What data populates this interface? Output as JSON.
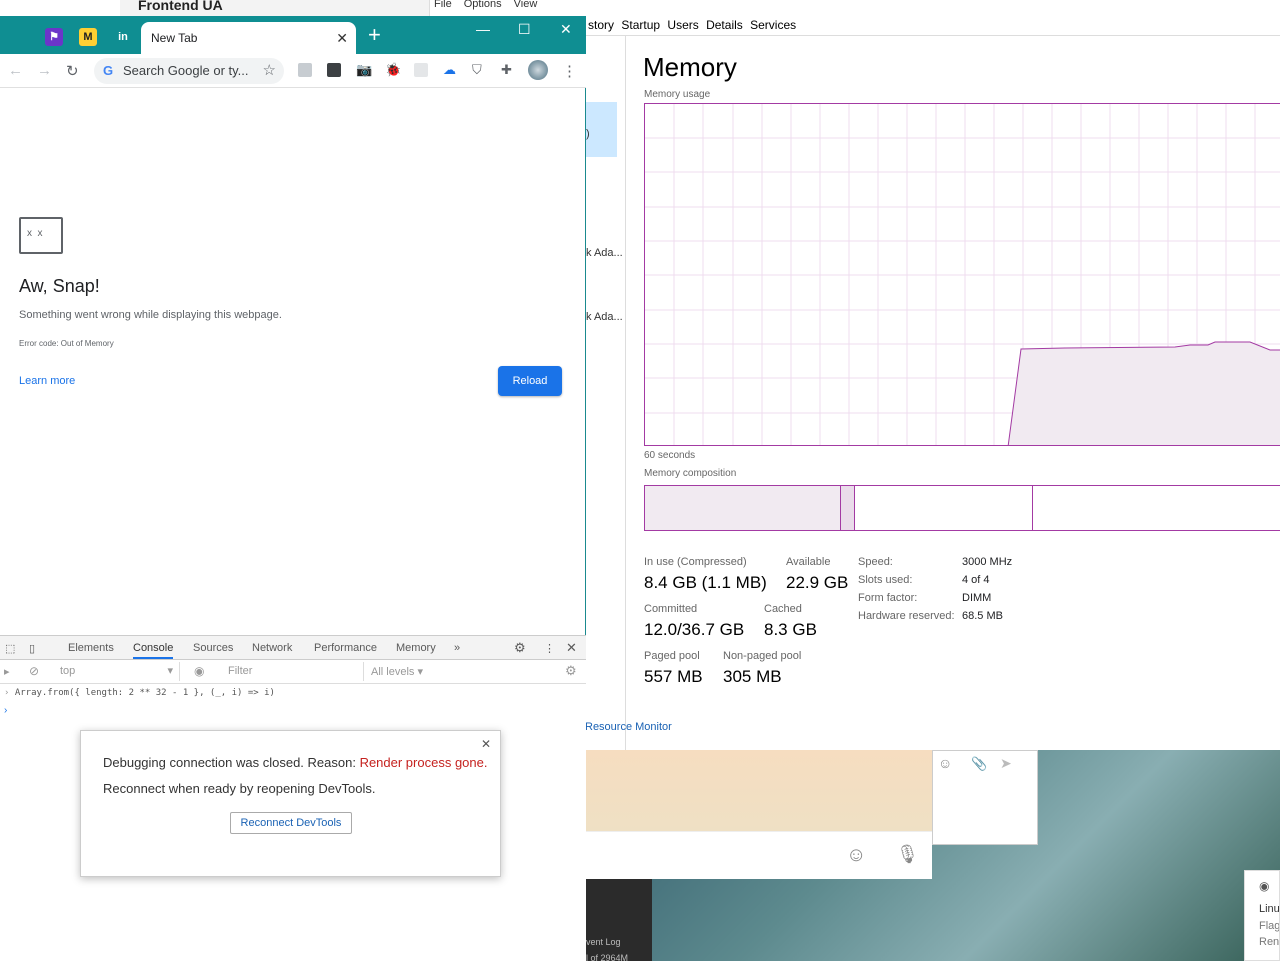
{
  "background": {
    "frontend_title": "Frontend UA",
    "menu": [
      "File",
      "Options",
      "View"
    ]
  },
  "task_manager": {
    "tabs": [
      "story",
      "Startup",
      "Users",
      "Details",
      "Services"
    ],
    "left_items": [
      ")",
      "k Ada...",
      "k Ada..."
    ],
    "title": "Memory",
    "usage_label": "Memory usage",
    "seconds_label": "60 seconds",
    "composition_label": "Memory composition",
    "stats": {
      "in_use_label": "In use (Compressed)",
      "in_use_value": "8.4 GB (1.1 MB)",
      "available_label": "Available",
      "available_value": "22.9 GB",
      "committed_label": "Committed",
      "committed_value": "12.0/36.7 GB",
      "cached_label": "Cached",
      "cached_value": "8.3 GB",
      "paged_label": "Paged pool",
      "paged_value": "557 MB",
      "nonpaged_label": "Non-paged pool",
      "nonpaged_value": "305 MB"
    },
    "specs": {
      "speed_label": "Speed:",
      "speed_value": "3000 MHz",
      "slots_label": "Slots used:",
      "slots_value": "4 of 4",
      "form_label": "Form factor:",
      "form_value": "DIMM",
      "hw_label": "Hardware reserved:",
      "hw_value": "68.5 MB"
    },
    "resource_monitor": "Resource Monitor"
  },
  "desktop": {
    "event_log": "vent Log",
    "event_sub": "l of 2964M",
    "notification": [
      "Linu",
      "Flag",
      "Ren"
    ]
  },
  "chrome": {
    "pinned_tabs": [
      "⚑",
      "M",
      "in"
    ],
    "tab_title": "New Tab",
    "omnibox_placeholder": "Search Google or ty...",
    "error": {
      "title": "Aw, Snap!",
      "message": "Something went wrong while displaying this webpage.",
      "code": "Error code: Out of Memory",
      "learn_more": "Learn more",
      "reload": "Reload"
    },
    "devtools": {
      "tabs": [
        "Elements",
        "Console",
        "Sources",
        "Network",
        "Performance",
        "Memory"
      ],
      "active_tab": "Console",
      "context": "top",
      "filter_placeholder": "Filter",
      "levels": "All levels ▾",
      "code": "Array.from({ length: 2 ** 32 - 1 }, (_, i) => i)",
      "dialog": {
        "line1_prefix": "Debugging connection was closed. Reason: ",
        "line1_reason": "Render process gone.",
        "line2": "Reconnect when ready by reopening DevTools.",
        "button": "Reconnect DevTools"
      }
    }
  }
}
